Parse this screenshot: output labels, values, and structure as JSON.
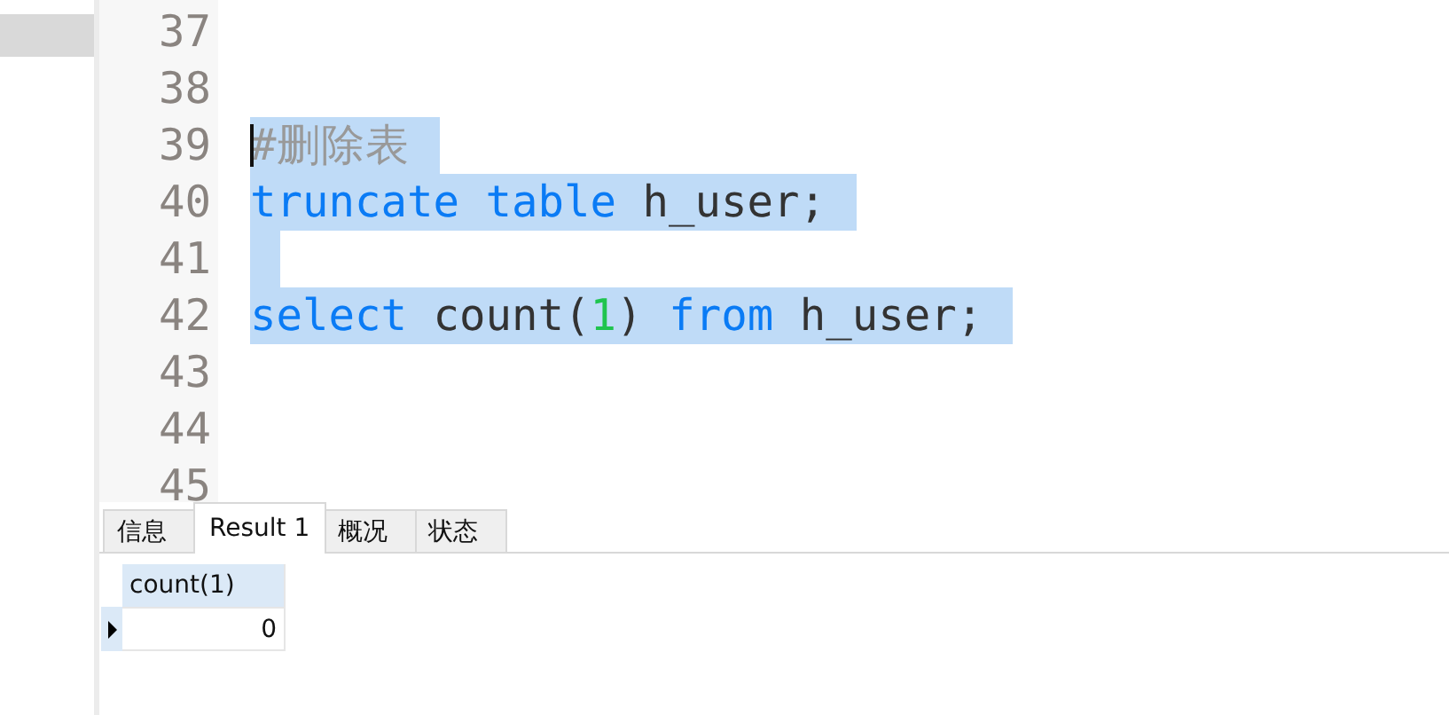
{
  "editor": {
    "lines": [
      {
        "number": "37",
        "selected": false
      },
      {
        "number": "38",
        "selected": false
      },
      {
        "number": "39",
        "selected": true,
        "tokens": [
          {
            "kind": "comment",
            "text": "#删除表"
          }
        ]
      },
      {
        "number": "40",
        "selected": true,
        "tokens": [
          {
            "kind": "keyword",
            "text": "truncate table"
          },
          {
            "kind": "plain",
            "text": " h_user;"
          }
        ]
      },
      {
        "number": "41",
        "selected": true
      },
      {
        "number": "42",
        "selected": true,
        "tokens": [
          {
            "kind": "keyword",
            "text": "select"
          },
          {
            "kind": "plain",
            "text": " count("
          },
          {
            "kind": "number",
            "text": "1"
          },
          {
            "kind": "plain",
            "text": ") "
          },
          {
            "kind": "keyword",
            "text": "from"
          },
          {
            "kind": "plain",
            "text": " h_user;"
          }
        ]
      },
      {
        "number": "43",
        "selected": false
      },
      {
        "number": "44",
        "selected": false
      },
      {
        "number": "45",
        "selected": false
      }
    ]
  },
  "tabs": [
    {
      "label": "信息",
      "selected": false
    },
    {
      "label": "Result 1",
      "selected": true
    },
    {
      "label": "概况",
      "selected": false
    },
    {
      "label": "状态",
      "selected": false
    }
  ],
  "result": {
    "columns": [
      "count(1)"
    ],
    "rows": [
      [
        "0"
      ]
    ]
  }
}
